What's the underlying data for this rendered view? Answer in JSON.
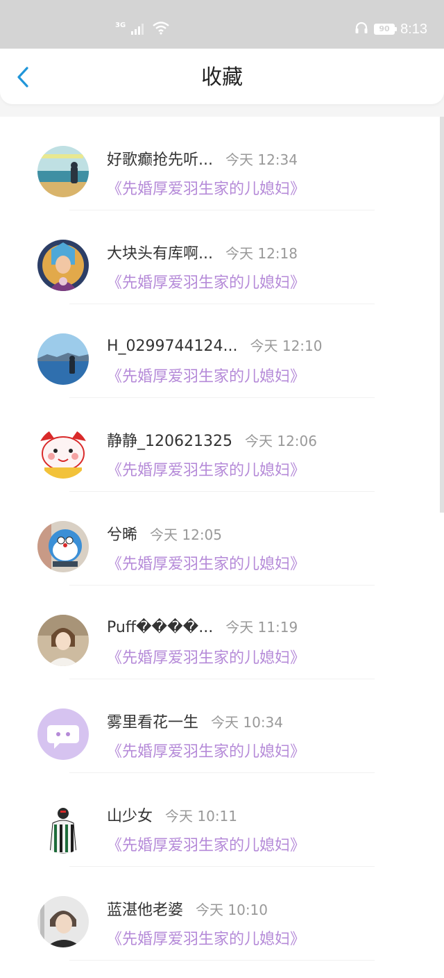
{
  "status_bar": {
    "network": "3G",
    "battery": "90",
    "time": "8:13",
    "icons": [
      "signal-icon",
      "wifi-icon",
      "headphones-icon",
      "battery-icon"
    ]
  },
  "header": {
    "title": "收藏",
    "back_icon": "chevron-left-icon"
  },
  "colors": {
    "accent": "#2196d9",
    "book_title": "#b58ad8",
    "status_bar_bg": "#d4d4d4"
  },
  "items": [
    {
      "name": "好歌癫抢先听...",
      "time": "今天 12:34",
      "book": "《先婚厚爱羽生家的儿媳妇》"
    },
    {
      "name": "大块头有库啊...",
      "time": "今天 12:18",
      "book": "《先婚厚爱羽生家的儿媳妇》"
    },
    {
      "name": "H_0299744124...",
      "time": "今天 12:10",
      "book": "《先婚厚爱羽生家的儿媳妇》"
    },
    {
      "name": "静静_120621325",
      "time": "今天 12:06",
      "book": "《先婚厚爱羽生家的儿媳妇》"
    },
    {
      "name": "兮晞",
      "time": "今天 12:05",
      "book": "《先婚厚爱羽生家的儿媳妇》"
    },
    {
      "name": "Puff����...",
      "time": "今天 11:19",
      "book": "《先婚厚爱羽生家的儿媳妇》"
    },
    {
      "name": "雾里看花一生",
      "time": "今天 10:34",
      "book": "《先婚厚爱羽生家的儿媳妇》"
    },
    {
      "name": "山少女",
      "time": "今天 10:11",
      "book": "《先婚厚爱羽生家的儿媳妇》"
    },
    {
      "name": "蓝湛他老婆",
      "time": "今天 10:10",
      "book": "《先婚厚爱羽生家的儿媳妇》"
    }
  ]
}
